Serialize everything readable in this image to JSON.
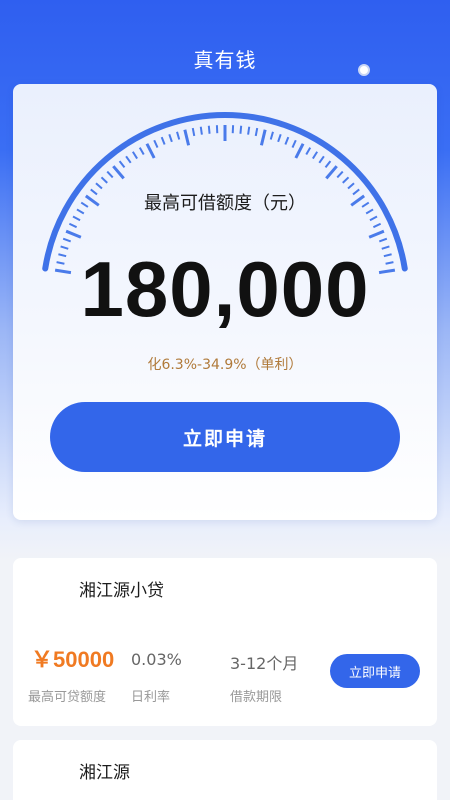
{
  "header": {
    "title": "真有钱"
  },
  "hero": {
    "max_label": "最高可借额度（元）",
    "amount": "180,000",
    "rate": "化6.3%-34.9%（单利）",
    "apply_label": "立即申请"
  },
  "products": [
    {
      "name": "湘江源小贷",
      "amount": "￥50000",
      "amount_label": "最高可贷额度",
      "rate": "0.03%",
      "rate_label": "日利率",
      "term": "3-12个月",
      "term_label": "借款期限",
      "apply_label": "立即申请"
    },
    {
      "name": "湘江源"
    }
  ],
  "colors": {
    "primary": "#3366ea",
    "accent_orange": "#f07a22",
    "rate_brown": "#b07a3a"
  }
}
